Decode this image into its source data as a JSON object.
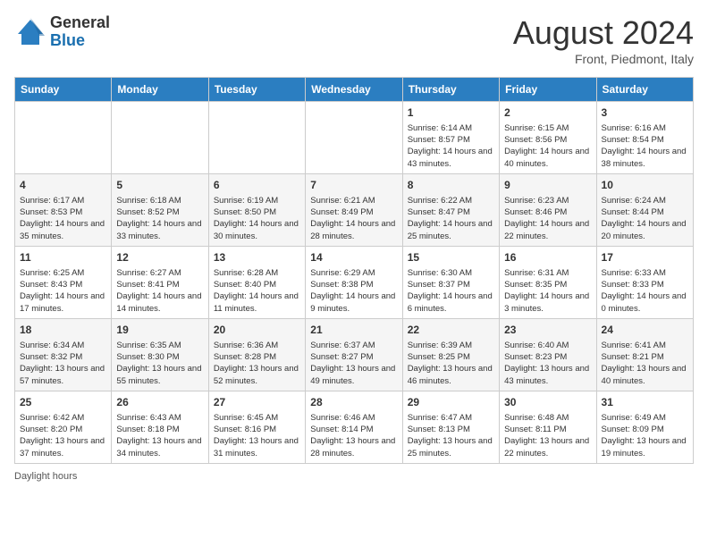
{
  "header": {
    "logo_general": "General",
    "logo_blue": "Blue",
    "main_title": "August 2024",
    "subtitle": "Front, Piedmont, Italy"
  },
  "days_of_week": [
    "Sunday",
    "Monday",
    "Tuesday",
    "Wednesday",
    "Thursday",
    "Friday",
    "Saturday"
  ],
  "weeks": [
    [
      {
        "day": "",
        "info": ""
      },
      {
        "day": "",
        "info": ""
      },
      {
        "day": "",
        "info": ""
      },
      {
        "day": "",
        "info": ""
      },
      {
        "day": "1",
        "info": "Sunrise: 6:14 AM\nSunset: 8:57 PM\nDaylight: 14 hours and 43 minutes."
      },
      {
        "day": "2",
        "info": "Sunrise: 6:15 AM\nSunset: 8:56 PM\nDaylight: 14 hours and 40 minutes."
      },
      {
        "day": "3",
        "info": "Sunrise: 6:16 AM\nSunset: 8:54 PM\nDaylight: 14 hours and 38 minutes."
      }
    ],
    [
      {
        "day": "4",
        "info": "Sunrise: 6:17 AM\nSunset: 8:53 PM\nDaylight: 14 hours and 35 minutes."
      },
      {
        "day": "5",
        "info": "Sunrise: 6:18 AM\nSunset: 8:52 PM\nDaylight: 14 hours and 33 minutes."
      },
      {
        "day": "6",
        "info": "Sunrise: 6:19 AM\nSunset: 8:50 PM\nDaylight: 14 hours and 30 minutes."
      },
      {
        "day": "7",
        "info": "Sunrise: 6:21 AM\nSunset: 8:49 PM\nDaylight: 14 hours and 28 minutes."
      },
      {
        "day": "8",
        "info": "Sunrise: 6:22 AM\nSunset: 8:47 PM\nDaylight: 14 hours and 25 minutes."
      },
      {
        "day": "9",
        "info": "Sunrise: 6:23 AM\nSunset: 8:46 PM\nDaylight: 14 hours and 22 minutes."
      },
      {
        "day": "10",
        "info": "Sunrise: 6:24 AM\nSunset: 8:44 PM\nDaylight: 14 hours and 20 minutes."
      }
    ],
    [
      {
        "day": "11",
        "info": "Sunrise: 6:25 AM\nSunset: 8:43 PM\nDaylight: 14 hours and 17 minutes."
      },
      {
        "day": "12",
        "info": "Sunrise: 6:27 AM\nSunset: 8:41 PM\nDaylight: 14 hours and 14 minutes."
      },
      {
        "day": "13",
        "info": "Sunrise: 6:28 AM\nSunset: 8:40 PM\nDaylight: 14 hours and 11 minutes."
      },
      {
        "day": "14",
        "info": "Sunrise: 6:29 AM\nSunset: 8:38 PM\nDaylight: 14 hours and 9 minutes."
      },
      {
        "day": "15",
        "info": "Sunrise: 6:30 AM\nSunset: 8:37 PM\nDaylight: 14 hours and 6 minutes."
      },
      {
        "day": "16",
        "info": "Sunrise: 6:31 AM\nSunset: 8:35 PM\nDaylight: 14 hours and 3 minutes."
      },
      {
        "day": "17",
        "info": "Sunrise: 6:33 AM\nSunset: 8:33 PM\nDaylight: 14 hours and 0 minutes."
      }
    ],
    [
      {
        "day": "18",
        "info": "Sunrise: 6:34 AM\nSunset: 8:32 PM\nDaylight: 13 hours and 57 minutes."
      },
      {
        "day": "19",
        "info": "Sunrise: 6:35 AM\nSunset: 8:30 PM\nDaylight: 13 hours and 55 minutes."
      },
      {
        "day": "20",
        "info": "Sunrise: 6:36 AM\nSunset: 8:28 PM\nDaylight: 13 hours and 52 minutes."
      },
      {
        "day": "21",
        "info": "Sunrise: 6:37 AM\nSunset: 8:27 PM\nDaylight: 13 hours and 49 minutes."
      },
      {
        "day": "22",
        "info": "Sunrise: 6:39 AM\nSunset: 8:25 PM\nDaylight: 13 hours and 46 minutes."
      },
      {
        "day": "23",
        "info": "Sunrise: 6:40 AM\nSunset: 8:23 PM\nDaylight: 13 hours and 43 minutes."
      },
      {
        "day": "24",
        "info": "Sunrise: 6:41 AM\nSunset: 8:21 PM\nDaylight: 13 hours and 40 minutes."
      }
    ],
    [
      {
        "day": "25",
        "info": "Sunrise: 6:42 AM\nSunset: 8:20 PM\nDaylight: 13 hours and 37 minutes."
      },
      {
        "day": "26",
        "info": "Sunrise: 6:43 AM\nSunset: 8:18 PM\nDaylight: 13 hours and 34 minutes."
      },
      {
        "day": "27",
        "info": "Sunrise: 6:45 AM\nSunset: 8:16 PM\nDaylight: 13 hours and 31 minutes."
      },
      {
        "day": "28",
        "info": "Sunrise: 6:46 AM\nSunset: 8:14 PM\nDaylight: 13 hours and 28 minutes."
      },
      {
        "day": "29",
        "info": "Sunrise: 6:47 AM\nSunset: 8:13 PM\nDaylight: 13 hours and 25 minutes."
      },
      {
        "day": "30",
        "info": "Sunrise: 6:48 AM\nSunset: 8:11 PM\nDaylight: 13 hours and 22 minutes."
      },
      {
        "day": "31",
        "info": "Sunrise: 6:49 AM\nSunset: 8:09 PM\nDaylight: 13 hours and 19 minutes."
      }
    ]
  ],
  "footer": "Daylight hours"
}
